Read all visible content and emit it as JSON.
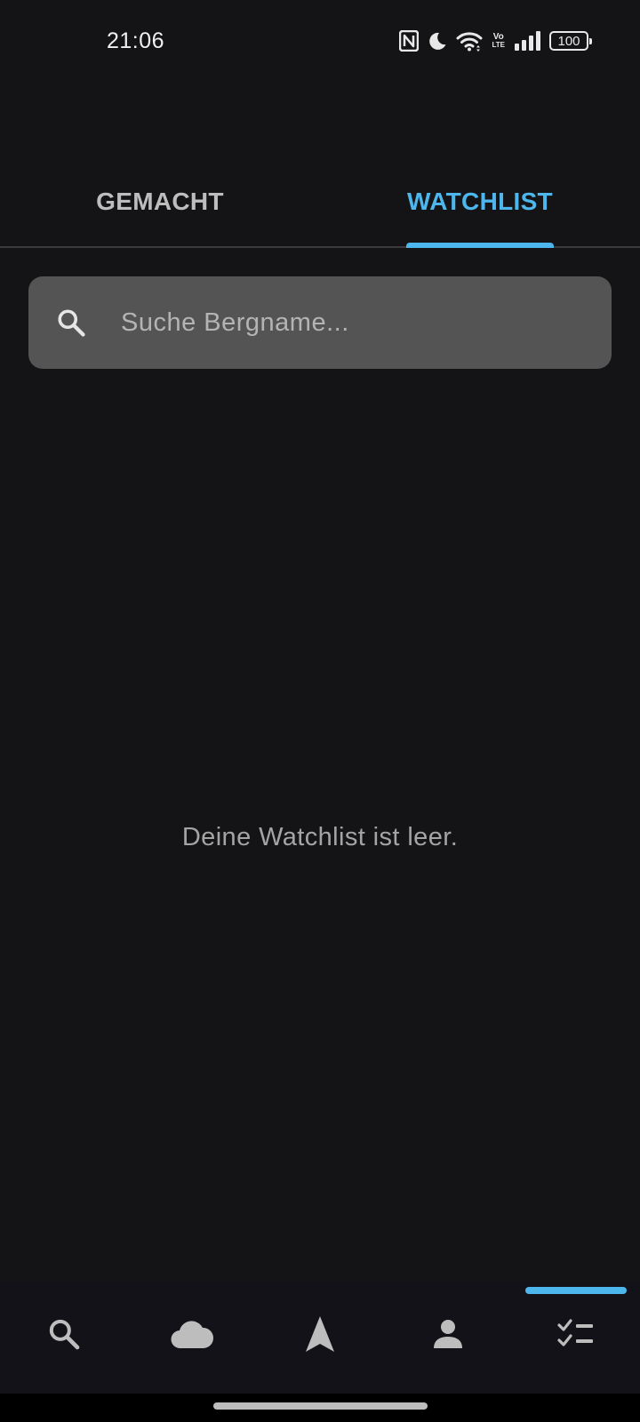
{
  "status_bar": {
    "time": "21:06",
    "battery": "100",
    "icons": [
      "nfc-icon",
      "moon-icon",
      "wifi-icon",
      "volte-icon",
      "signal-icon",
      "battery-icon"
    ],
    "volte_top": "Vo",
    "volte_bottom": "LTE"
  },
  "tabs": [
    {
      "label": "GEMACHT",
      "active": false
    },
    {
      "label": "WATCHLIST",
      "active": true
    }
  ],
  "search": {
    "placeholder": "Suche Bergname...",
    "value": ""
  },
  "empty_state": {
    "message": "Deine Watchlist ist leer."
  },
  "bottom_nav": {
    "items": [
      {
        "icon": "search-icon",
        "active": false
      },
      {
        "icon": "cloud-icon",
        "active": false
      },
      {
        "icon": "navigation-arrow-icon",
        "active": false
      },
      {
        "icon": "person-icon",
        "active": false
      },
      {
        "icon": "checklist-icon",
        "active": true
      }
    ]
  },
  "colors": {
    "accent": "#4db6ec",
    "background": "#141315",
    "search_background": "#545454",
    "nav_background": "#131219",
    "inactive_icon": "#bdbdbd"
  }
}
